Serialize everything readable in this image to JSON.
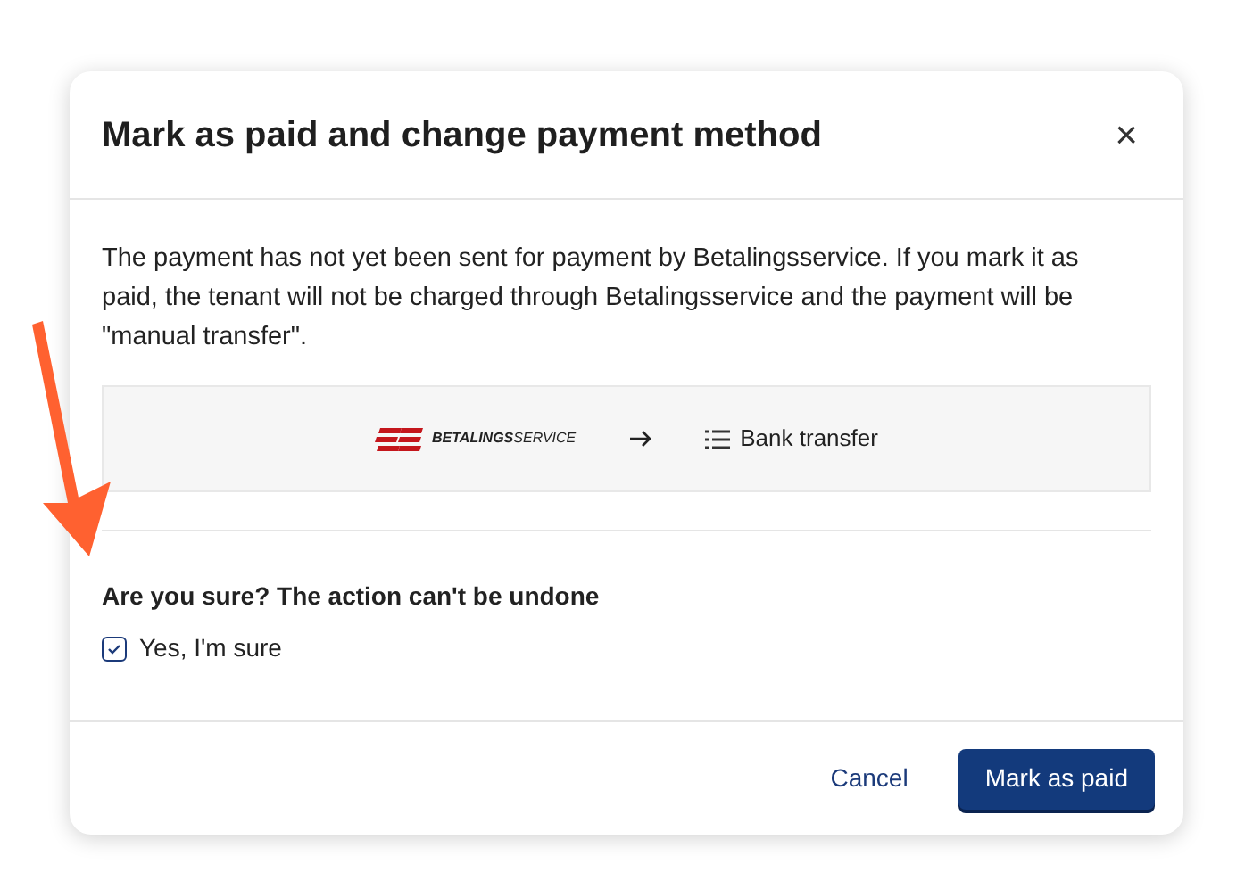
{
  "dialog": {
    "title": "Mark as paid and change payment method",
    "close": "×",
    "description": "The payment has not yet been sent for payment by Betalingsservice. If you mark it as paid, the tenant will not be charged through Betalingsservice and the payment will be \"manual transfer\".",
    "from_logo": {
      "bold": "BETALINGS",
      "light": "SERVICE"
    },
    "to_method": "Bank transfer",
    "question": "Are you sure? The action can't be undone",
    "confirm": {
      "label": "Yes, I'm sure",
      "checked": true
    },
    "buttons": [
      {
        "label": "Cancel",
        "kind": "link"
      },
      {
        "label": "Mark as paid",
        "kind": "primary"
      }
    ]
  }
}
